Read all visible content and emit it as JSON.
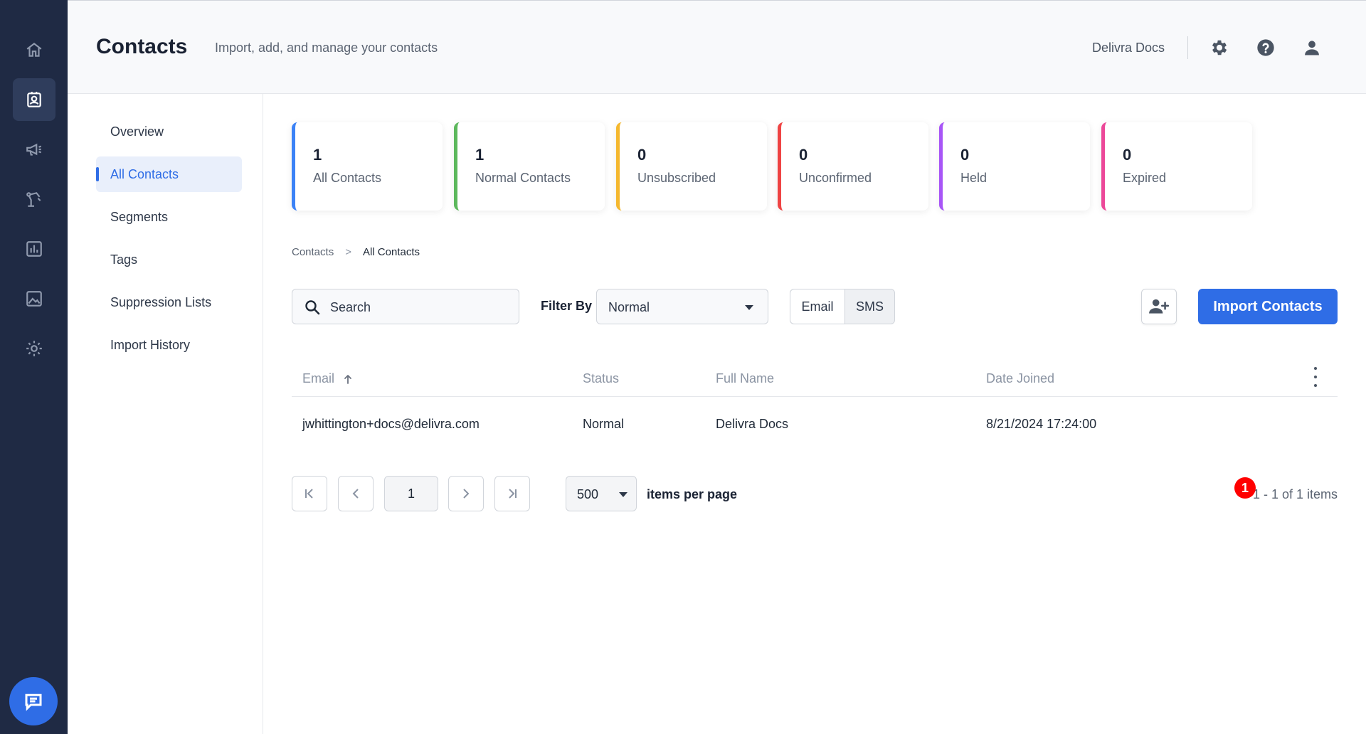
{
  "header": {
    "title": "Contacts",
    "subtitle": "Import, add, and manage your contacts",
    "account_name": "Delivra Docs"
  },
  "rail": {
    "items": [
      {
        "icon": "home-icon"
      },
      {
        "icon": "contacts-icon",
        "active": true
      },
      {
        "icon": "megaphone-icon"
      },
      {
        "icon": "automation-icon"
      },
      {
        "icon": "reports-icon"
      },
      {
        "icon": "image-library-icon"
      },
      {
        "icon": "settings-icon"
      }
    ],
    "chat_icon": "chat-icon"
  },
  "subnav": {
    "items": [
      {
        "label": "Overview"
      },
      {
        "label": "All Contacts",
        "active": true
      },
      {
        "label": "Segments"
      },
      {
        "label": "Tags"
      },
      {
        "label": "Suppression Lists"
      },
      {
        "label": "Import History"
      }
    ]
  },
  "stats": [
    {
      "value": "1",
      "label": "All Contacts",
      "color": "#3b82f6"
    },
    {
      "value": "1",
      "label": "Normal Contacts",
      "color": "#5cb85c"
    },
    {
      "value": "0",
      "label": "Unsubscribed",
      "color": "#f5b82e"
    },
    {
      "value": "0",
      "label": "Unconfirmed",
      "color": "#ef4444"
    },
    {
      "value": "0",
      "label": "Held",
      "color": "#a855f7"
    },
    {
      "value": "0",
      "label": "Expired",
      "color": "#ec4899"
    }
  ],
  "breadcrumb": {
    "root": "Contacts",
    "separator": ">",
    "current": "All Contacts"
  },
  "toolbar": {
    "search_placeholder": "Search",
    "filter_label": "Filter By",
    "filter_value": "Normal",
    "channel_email": "Email",
    "channel_sms": "SMS",
    "import_label": "Import Contacts"
  },
  "table": {
    "columns": [
      "Email",
      "Status",
      "Full Name",
      "Date Joined"
    ],
    "rows": [
      {
        "email": "jwhittington+docs@delivra.com",
        "status": "Normal",
        "full_name": "Delivra Docs",
        "date_joined": "8/21/2024 17:24:00"
      }
    ]
  },
  "pagination": {
    "current_page": "1",
    "per_page": "500",
    "per_page_label": "items per page",
    "summary": "1 - 1 of 1 items",
    "badge": "1"
  },
  "colors": {
    "rail_bg": "#1f2a44",
    "accent": "#2f6de6"
  }
}
